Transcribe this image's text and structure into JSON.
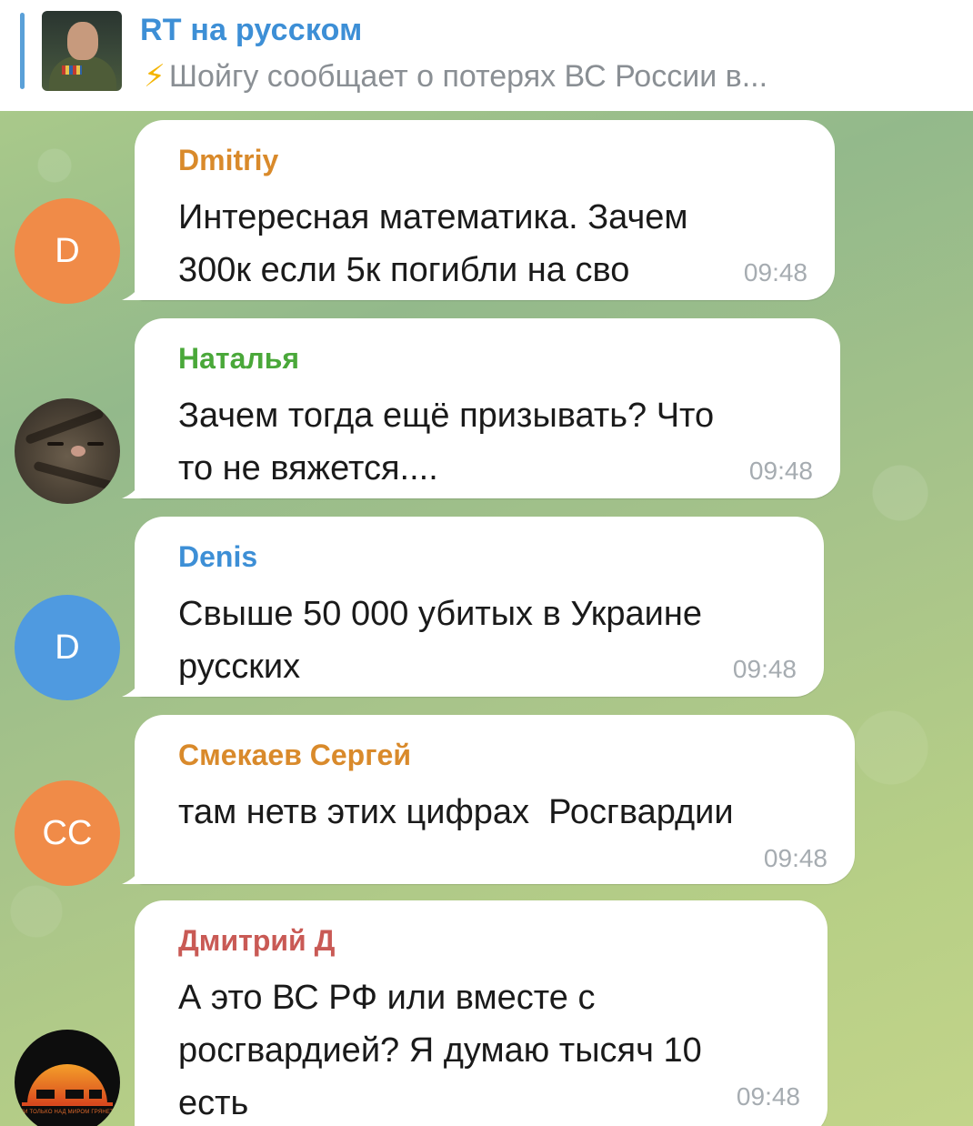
{
  "pinned": {
    "title": "RT на русском",
    "text": "Шойгу сообщает о потерях ВС России в...",
    "bolt": "⚡"
  },
  "messages": [
    {
      "avatar_initials": "D",
      "avatar_color": "#f08b48",
      "name": "Dmitriy",
      "name_color": "#d98a2b",
      "text": "Интересная математика. Зачем\n300к если 5к погибли на сво",
      "time": "09:48"
    },
    {
      "avatar_initials": "",
      "avatar_icon": "cat-photo",
      "name": "Наталья",
      "name_color": "#4aa83a",
      "text": "Зачем тогда ещё призывать? Что\nто не вяжется....",
      "time": "09:48"
    },
    {
      "avatar_initials": "D",
      "avatar_color": "#4f9ae0",
      "name": "Denis",
      "name_color": "#3d8fd6",
      "text": "Свыше 50 000 убитых в Украине\nрусских",
      "time": "09:48"
    },
    {
      "avatar_initials": "CC",
      "avatar_color": "#f08b48",
      "name": "Смекаев Сергей",
      "name_color": "#d98a2b",
      "text": "там нетв этих цифрах  Росгвардии",
      "time": "09:48"
    },
    {
      "avatar_initials": "",
      "avatar_icon": "emblem-logo",
      "name": "Дмитрий Д",
      "name_color": "#c95a55",
      "text": "А это ВС РФ или вместе с\nросгвардией? Я думаю тысяч 10\nесть",
      "time": "09:48"
    }
  ],
  "colors": {
    "accent": "#3d8fd6",
    "bubble": "#ffffff",
    "time": "#a6acb1"
  }
}
